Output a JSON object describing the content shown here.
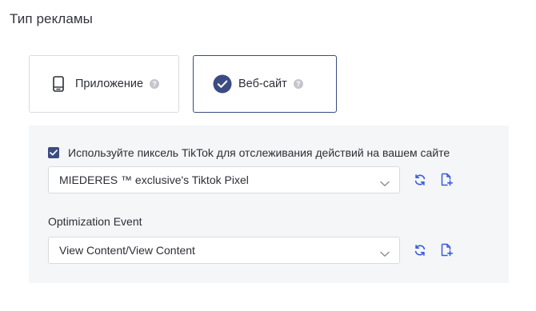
{
  "section": {
    "title": "Тип рекламы"
  },
  "ad_types": {
    "app": {
      "label": "Приложение",
      "icon": "phone-icon",
      "selected": false
    },
    "website": {
      "label": "Веб-сайт",
      "icon": "check-circle-icon",
      "selected": true
    },
    "help_glyph": "?"
  },
  "pixel": {
    "checkbox_checked": true,
    "checkbox_label": "Используйте пиксель TikTok для отслеживания действий на вашем сайте",
    "selected": "MIEDERES ™ exclusive's Tiktok Pixel"
  },
  "optimization_event": {
    "label": "Optimization Event",
    "selected": "View Content/View Content"
  },
  "colors": {
    "accent": "#3c4b82",
    "tool_icon": "#3b5bd6",
    "panel_bg": "#f5f6f8",
    "border": "#d9dbe0"
  }
}
